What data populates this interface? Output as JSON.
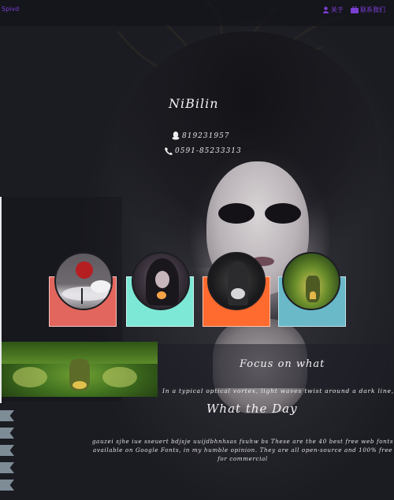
{
  "nav": {
    "home": "Spivd",
    "link_a": "关于",
    "link_b": "联系我们"
  },
  "hero": {
    "title": "NiBilin",
    "qq": "819231957",
    "phone": "0591-85233313"
  },
  "cards": [
    {
      "name": "blood-moon",
      "color": "#e2665d"
    },
    {
      "name": "dark-witch",
      "color": "#7ee8d6"
    },
    {
      "name": "crystal-ball",
      "color": "#ff6a2f"
    },
    {
      "name": "tree-house",
      "color": "#69b9c9"
    }
  ],
  "focus": {
    "heading": "Focus on what",
    "text": "In a typical optical vortex, light waves twist around a dark line, or"
  },
  "about": {
    "heading": "What the Day",
    "lines": [
      "gauzei sjhe iue sseuert bdjsje uuijdbhnhsas fsuhw bs These are the 40 best free web fonts",
      "available on Google Fonts, in my humble opinion. They are all open-source and 100% free",
      "for commercial"
    ]
  },
  "colors": {
    "nav_link": "#7a3fd1",
    "ribbon": "#7e8c96"
  }
}
